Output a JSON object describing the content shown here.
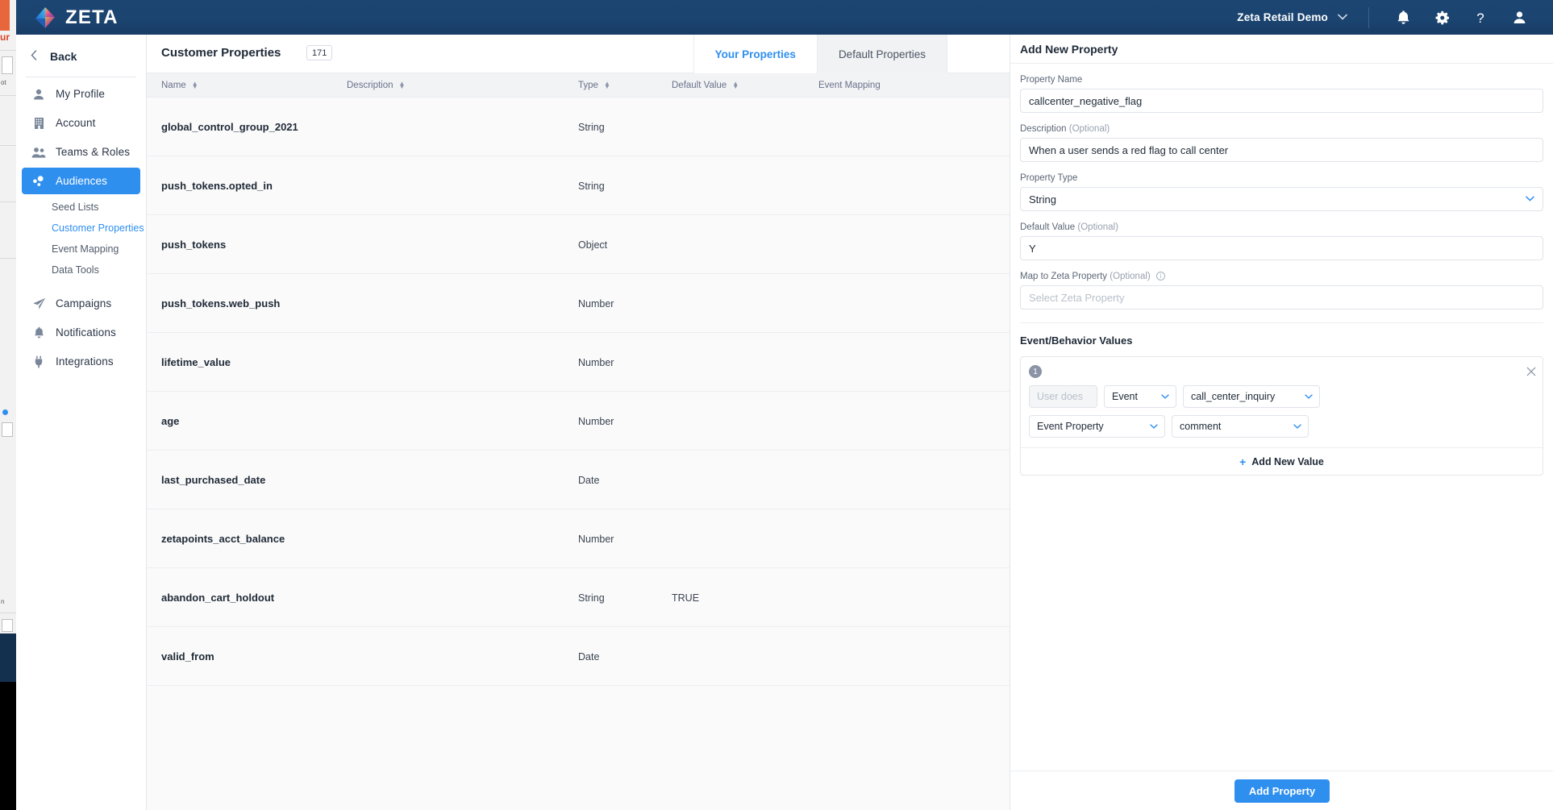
{
  "topbar": {
    "brand": "ZETA",
    "logo_icon": "zeta-diamond-logo",
    "account_name": "Zeta Retail Demo",
    "account_caret_icon": "chevron-down-icon",
    "icons": [
      {
        "name": "notifications-bell-icon",
        "glyph": "bell"
      },
      {
        "name": "settings-gear-icon",
        "glyph": "gear"
      },
      {
        "name": "help-question-icon",
        "glyph": "question"
      },
      {
        "name": "user-profile-icon",
        "glyph": "user"
      }
    ]
  },
  "sidebar": {
    "back_label": "Back",
    "back_icon": "chevron-left-icon",
    "items": [
      {
        "label": "My Profile",
        "icon": "person-icon",
        "active": false
      },
      {
        "label": "Account",
        "icon": "building-icon",
        "active": false
      },
      {
        "label": "Teams & Roles",
        "icon": "people-icon",
        "active": false
      },
      {
        "label": "Audiences",
        "icon": "audiences-icon",
        "active": true
      }
    ],
    "sub_items": [
      {
        "label": "Seed Lists",
        "active": false
      },
      {
        "label": "Customer Properties",
        "active": true
      },
      {
        "label": "Event Mapping",
        "active": false
      },
      {
        "label": "Data Tools",
        "active": false
      }
    ],
    "items_bottom": [
      {
        "label": "Campaigns",
        "icon": "paper-plane-icon",
        "active": false
      },
      {
        "label": "Notifications",
        "icon": "bell-icon",
        "active": false
      },
      {
        "label": "Integrations",
        "icon": "plug-icon",
        "active": false
      }
    ]
  },
  "main": {
    "page_title": "Customer Properties",
    "count_badge": "171",
    "tabs": [
      {
        "label": "Your Properties",
        "active": true
      },
      {
        "label": "Default Properties",
        "active": false
      }
    ],
    "table": {
      "columns": [
        {
          "label": "Name",
          "sortable": true
        },
        {
          "label": "Description",
          "sortable": true
        },
        {
          "label": "Type",
          "sortable": true
        },
        {
          "label": "Default Value",
          "sortable": true
        },
        {
          "label": "Event Mapping",
          "sortable": false
        }
      ],
      "rows": [
        {
          "name": "global_control_group_2021",
          "description": "",
          "type": "String",
          "default_value": "",
          "event_mapping": ""
        },
        {
          "name": "push_tokens.opted_in",
          "description": "",
          "type": "String",
          "default_value": "",
          "event_mapping": ""
        },
        {
          "name": "push_tokens",
          "description": "",
          "type": "Object",
          "default_value": "",
          "event_mapping": ""
        },
        {
          "name": "push_tokens.web_push",
          "description": "",
          "type": "Number",
          "default_value": "",
          "event_mapping": ""
        },
        {
          "name": "lifetime_value",
          "description": "",
          "type": "Number",
          "default_value": "",
          "event_mapping": ""
        },
        {
          "name": "age",
          "description": "",
          "type": "Number",
          "default_value": "",
          "event_mapping": ""
        },
        {
          "name": "last_purchased_date",
          "description": "",
          "type": "Date",
          "default_value": "",
          "event_mapping": ""
        },
        {
          "name": "zetapoints_acct_balance",
          "description": "",
          "type": "Number",
          "default_value": "",
          "event_mapping": ""
        },
        {
          "name": "abandon_cart_holdout",
          "description": "",
          "type": "String",
          "default_value": "TRUE",
          "event_mapping": ""
        },
        {
          "name": "valid_from",
          "description": "",
          "type": "Date",
          "default_value": "",
          "event_mapping": ""
        }
      ]
    }
  },
  "panel": {
    "title": "Add New Property",
    "property_name": {
      "label": "Property Name",
      "value": "callcenter_negative_flag"
    },
    "description": {
      "label": "Description",
      "optional": "(Optional)",
      "value": "When a user sends a red flag to call center"
    },
    "property_type": {
      "label": "Property Type",
      "value": "String",
      "caret_icon": "chevron-down-icon"
    },
    "default_value": {
      "label": "Default Value",
      "optional": "(Optional)",
      "value": "Y"
    },
    "map_to_zeta": {
      "label": "Map to Zeta Property",
      "optional": "(Optional)",
      "info_icon": "info-circle-icon",
      "placeholder": "Select Zeta Property",
      "value": ""
    },
    "event_behavior": {
      "section_title": "Event/Behavior Values",
      "rows": [
        {
          "number": "1",
          "close_icon": "close-icon",
          "prefix": "User does",
          "kind": "Event",
          "event": "call_center_inquiry",
          "property_kind": "Event Property",
          "property": "comment"
        }
      ],
      "add_label": "Add New Value",
      "add_icon": "plus-icon"
    },
    "submit_label": "Add Property"
  },
  "colors": {
    "brand_navy": "#1c4573",
    "accent_blue": "#2f8fef",
    "page_bg": "#fafafa",
    "header_bg": "#f2f3f5"
  }
}
